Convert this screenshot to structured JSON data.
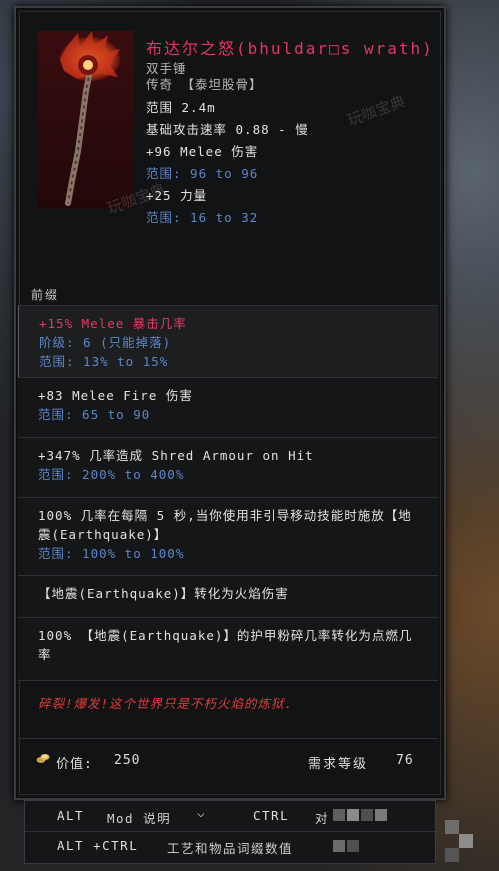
{
  "item": {
    "name": "布达尔之怒(bhuldar□s wrath)",
    "type": "双手锤",
    "rarity_line": "传奇 【泰坦股骨】",
    "range": "范围 2.4m",
    "attack_speed": "基础攻击速率 0.88 - 慢",
    "implicits": [
      {
        "stat": "+96 Melee 伤害",
        "range": "范围: 96 to 96"
      },
      {
        "stat": "+25 力量",
        "range": "范围: 16 to 32"
      }
    ]
  },
  "prefix_label": "前缀",
  "affixes": [
    {
      "stat": "+15% Melee 暴击几率",
      "tier": "阶级: 6 (只能掉落)",
      "range": "范围: 13% to 15%"
    },
    {
      "stat": "+83 Melee Fire 伤害",
      "range": "范围: 65 to 90"
    },
    {
      "stat": "+347% 几率造成 Shred Armour on Hit",
      "range": "范围: 200% to 400%"
    },
    {
      "stat": "100% 几率在每隔 5 秒,当你使用非引导移动技能时施放【地震(Earthquake)】",
      "range": "范围: 100% to 100%"
    },
    {
      "stat": "【地震(Earthquake)】转化为火焰伤害"
    },
    {
      "stat": "100% 【地震(Earthquake)】的护甲粉碎几率转化为点燃几率"
    }
  ],
  "flavor": "碎裂!爆发!这个世界只是不朽火焰的炼狱.",
  "footer": {
    "value_label": "价值:",
    "value": "250",
    "req_label": "需求等级",
    "req_level": "76"
  },
  "hints": {
    "alt_key": "ALT",
    "alt_text": "Mod 说明",
    "ctrl_key": "CTRL",
    "ctrl_text": "对",
    "altctrl_key": "ALT +CTRL",
    "altctrl_text": "工艺和物品词缀数值"
  },
  "watermark": "玩咖宝典",
  "colors": {
    "unique_name": "#e8336a",
    "range_blue": "#5d86c9",
    "flavor_red": "#e03c3c"
  }
}
